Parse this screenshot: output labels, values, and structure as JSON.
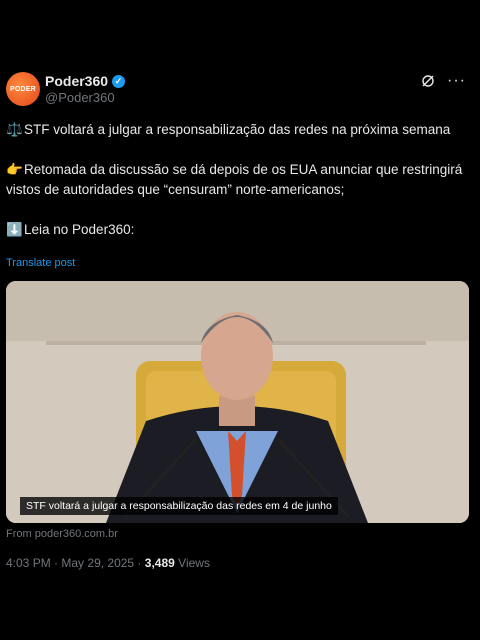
{
  "author": {
    "avatar_text": "PODER",
    "name": "Poder360",
    "handle": "@Poder360",
    "verified_color": "#1d9bf0"
  },
  "tweet": {
    "para1": "STF voltará a julgar a responsabilização das redes na próxima semana",
    "para2": "Retomada da discussão se dá depois de os EUA anunciar que restringirá vistos de autoridades que “censuram” norte-americanos;",
    "para3": "Leia no Poder360:",
    "translate_label": "Translate post",
    "emoji1": "⚖️",
    "emoji2": "👉",
    "emoji3": "⬇️"
  },
  "media": {
    "caption": "STF voltará a julgar a responsabilização das redes em 4 de junho",
    "source": "From poder360.com.br"
  },
  "meta": {
    "time": "4:03 PM",
    "date": "May 29, 2025",
    "views_count": "3,489",
    "views_label": "Views"
  },
  "icons": {
    "grok": "grok-icon",
    "more": "more-icon",
    "verified": "verified-badge-icon"
  }
}
